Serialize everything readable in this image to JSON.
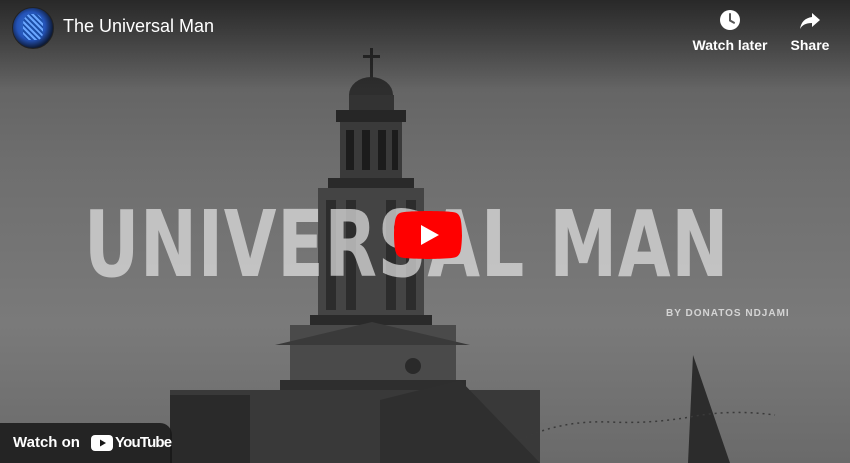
{
  "video": {
    "title": "The Universal Man",
    "overlay_title": "UNIVERSAL MAN",
    "overlay_byline": "BY DONATOS NDJAMI"
  },
  "actions": {
    "watch_later_label": "Watch later",
    "share_label": "Share"
  },
  "footer": {
    "watch_on_label": "Watch on",
    "brand": "YouTube"
  },
  "colors": {
    "play_red": "#ff0000",
    "text": "#ffffff"
  },
  "icons": [
    "channel-avatar",
    "clock-icon",
    "share-arrow-icon",
    "play-icon",
    "youtube-logo-icon"
  ]
}
